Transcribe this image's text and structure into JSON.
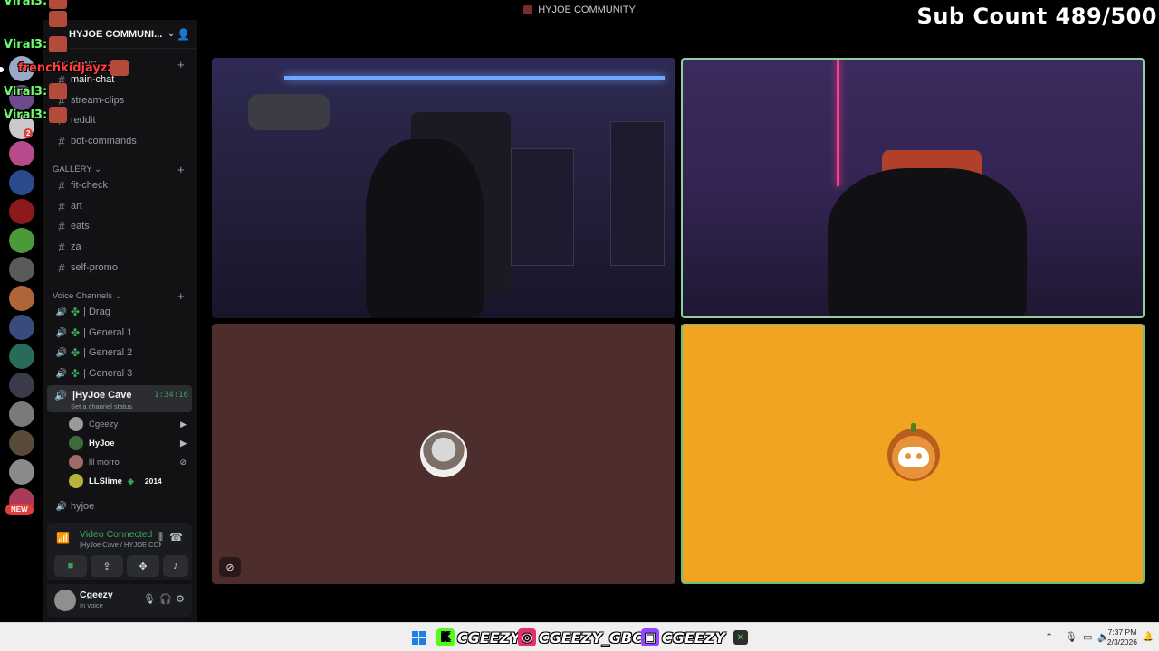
{
  "window": {
    "title": "HYJOE COMMUNITY"
  },
  "overlay": {
    "sub_count": "Sub Count 489/500",
    "chat_lines": [
      {
        "text": "Viral3:",
        "color": "green"
      },
      {
        "text": "Viral3:",
        "color": "green"
      },
      {
        "text": "frenchkidjayzz:",
        "color": "red"
      },
      {
        "text": "Viral3:",
        "color": "green"
      },
      {
        "text": "Viral3:",
        "color": "green"
      }
    ]
  },
  "server": {
    "name": "HYJOE COMMUNI...",
    "rail_badges": {
      "mention_count": "2",
      "new_label": "NEW"
    }
  },
  "channels": {
    "categories": [
      {
        "name": "JOE GANG"
      },
      {
        "name": "GALLERY"
      },
      {
        "name": "Voice Channels"
      }
    ],
    "text": [
      {
        "name": "main-chat"
      },
      {
        "name": "stream-clips"
      },
      {
        "name": "reddit"
      },
      {
        "name": "bot-commands"
      },
      {
        "name": "fit-check"
      },
      {
        "name": "art"
      },
      {
        "name": "eats"
      },
      {
        "name": "za"
      },
      {
        "name": "self-promo"
      }
    ],
    "voice": [
      {
        "name": "| Drag"
      },
      {
        "name": "| General 1"
      },
      {
        "name": "| General 2"
      },
      {
        "name": "| General 3"
      }
    ],
    "active_voice": {
      "name": "|HyJoe Cave",
      "timer": "1:34:16",
      "status": "Set a channel status"
    },
    "voice_users": [
      {
        "name": "Cgeezy",
        "badge": ""
      },
      {
        "name": "HyJoe",
        "badge": ""
      },
      {
        "name": "lil morro",
        "badge": ""
      },
      {
        "name": "LLSlime",
        "badge": "2014"
      }
    ],
    "trailing_voice": {
      "name": "hyjoe"
    }
  },
  "voice_panel": {
    "status": "Video Connected",
    "location": "|HyJoe Cave / HYJOE COM..."
  },
  "user_panel": {
    "name": "Cgeezy",
    "status": "In voice"
  },
  "taskbar": {
    "socials": [
      {
        "handle": "CGEEZY",
        "logo": "K",
        "color": "#53fc18"
      },
      {
        "handle": "CGEEZY_GBC",
        "logo": "◎",
        "color": "#e1306c"
      },
      {
        "handle": "CGEEZY",
        "logo": "▣",
        "color": "#9146ff"
      }
    ],
    "time": "7:37 PM",
    "date": "2/3/2026"
  }
}
